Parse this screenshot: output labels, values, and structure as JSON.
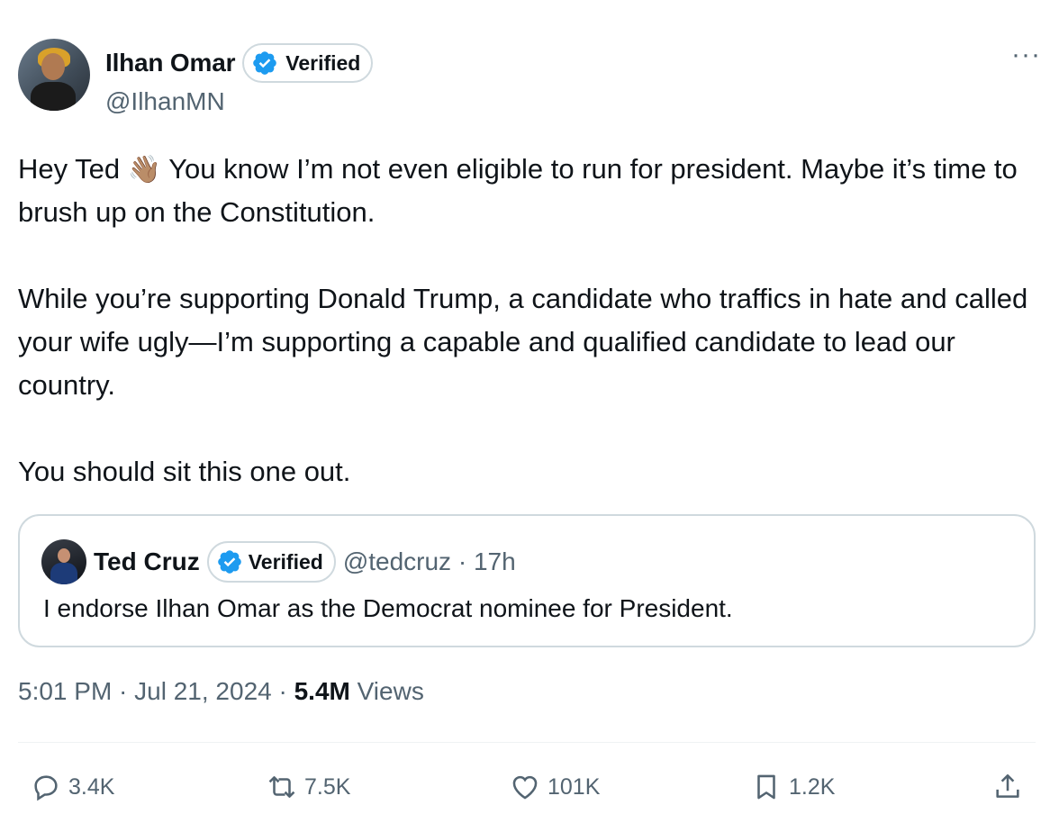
{
  "author": {
    "name": "Ilhan Omar",
    "verified_label": "Verified",
    "handle": "@IlhanMN",
    "avatar_icon": "profile-photo"
  },
  "more_label": "···",
  "tweet": {
    "line1_a": "Hey Ted",
    "wave_emoji": "👋🏽",
    "line1_b": " You know I’m not even eligible to run for president. Maybe it’s time to brush up on the Constitution.",
    "para2": "While you’re supporting Donald Trump, a candidate who traffics in hate and called your wife ugly—I’m supporting a capable and qualified candidate to lead our country.",
    "para3": "You should sit this one out."
  },
  "quote": {
    "name": "Ted Cruz",
    "verified_label": "Verified",
    "meta": "@tedcruz · 17h",
    "text": "I endorse Ilhan Omar as the Democrat nominee for President."
  },
  "timestamp": {
    "time": "5:01 PM · Jul 21, 2024 · ",
    "views_count": "5.4M",
    "views_label": " Views"
  },
  "actions": {
    "reply_count": "3.4K",
    "retweet_count": "7.5K",
    "like_count": "101K",
    "bookmark_count": "1.2K"
  },
  "colors": {
    "text": "#0f1419",
    "muted": "#536471",
    "border": "#cfd9de",
    "verified": "#1d9bf0"
  }
}
